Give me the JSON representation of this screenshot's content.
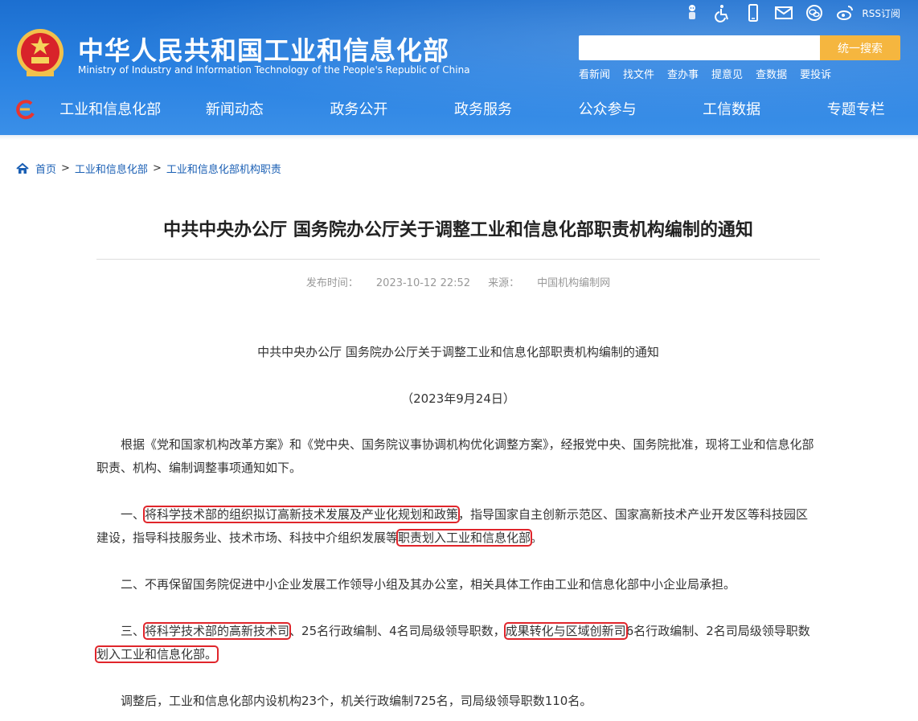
{
  "header": {
    "title_cn": "中华人民共和国工业和信息化部",
    "title_en": "Ministry of Industry and Information Technology of the People's Republic of China",
    "rss_label": "RSS订阅",
    "top_icons": [
      "accessibility-robot-icon",
      "wheelchair-icon",
      "mobile-icon",
      "mail-icon",
      "wechat-icon",
      "weibo-icon"
    ],
    "search": {
      "placeholder": "",
      "button_label": "统一搜索"
    },
    "quick_links": [
      "看新闻",
      "找文件",
      "查办事",
      "提意见",
      "查数据",
      "要投诉"
    ],
    "nav": [
      "工业和信息化部",
      "新闻动态",
      "政务公开",
      "政务服务",
      "公众参与",
      "工信数据",
      "专题专栏"
    ]
  },
  "breadcrumb": {
    "items": [
      "首页",
      "工业和信息化部",
      "工业和信息化部机构职责"
    ],
    "separator": ">"
  },
  "article": {
    "title": "中共中央办公厅 国务院办公厅关于调整工业和信息化部职责机构编制的通知",
    "publish_label": "发布时间：",
    "publish_time": "2023-10-12 22:52",
    "source_label": "来源：",
    "source": "中国机构编制网",
    "heading": "中共中央办公厅 国务院办公厅关于调整工业和信息化部职责机构编制的通知",
    "date": "（2023年9月24日）",
    "p1": "根据《党和国家机构改革方案》和《党中央、国务院议事协调机构优化调整方案》，经报党中央、国务院批准，现将工业和信息化部职责、机构、编制调整事项通知如下。",
    "p2": {
      "a": "一、",
      "b": "将科学技术部的组织拟订高新技术发展及产业化规划和政策",
      "c": "，指导国家自主创新示范区、国家高新技术产业开发区等科技园区建设，指导科技服务业、技术市场、科技中介组织发展等",
      "d": "职责划入工业和信息化部",
      "e": "。"
    },
    "p3": "二、不再保留国务院促进中小企业发展工作领导小组及其办公室，相关具体工作由工业和信息化部中小企业局承担。",
    "p4": {
      "a": "三、",
      "b": "将科学技术部的高新技术司",
      "c": "、25名行政编制、4名司局级领导职数，",
      "d": "成果转化与区域创新司",
      "e": "6名行政编制、2名司局级领导职数",
      "f": "划入工业和信息化部。"
    },
    "p5": "调整后，工业和信息化部内设机构23个，机关行政编制725名，司局级领导职数110名。"
  },
  "colors": {
    "header_blue": "#2a82e2",
    "search_button": "#f5b63f",
    "highlight_box": "#e0252b",
    "link": "#1a5fb4"
  }
}
